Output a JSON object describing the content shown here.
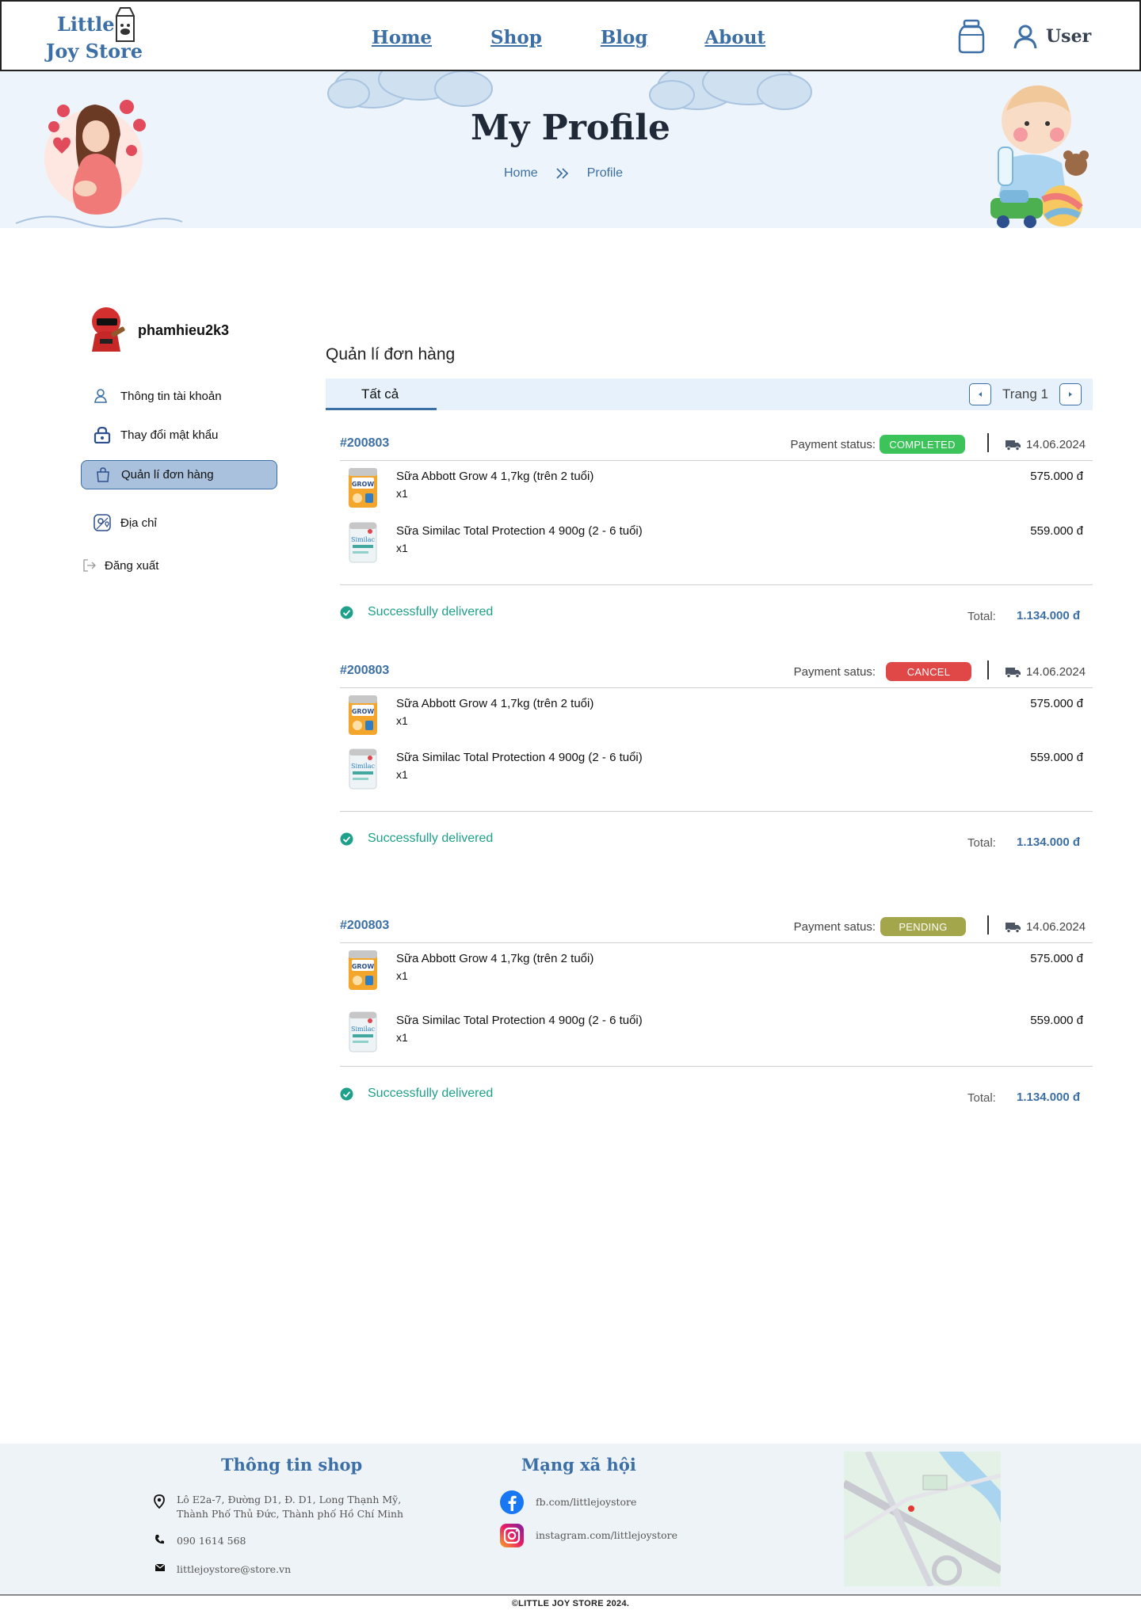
{
  "header": {
    "logo_line1": "Little",
    "logo_line2": "Joy Store",
    "nav": [
      "Home",
      "Shop",
      "Blog",
      "About"
    ],
    "user_label": "User"
  },
  "hero": {
    "title": "My Profile",
    "breadcrumb": [
      "Home",
      "Profile"
    ]
  },
  "sidebar": {
    "username": "phamhieu2k3",
    "menu": [
      {
        "label": "Thông tin tài khoản",
        "icon": "user-icon"
      },
      {
        "label": "Thay đổi mật khẩu",
        "icon": "lock-icon"
      },
      {
        "label": "Quản lí đơn hàng",
        "icon": "shopping-bag-icon",
        "active": true
      },
      {
        "label": "Địa chỉ",
        "icon": "map-pin-icon"
      },
      {
        "label": "Đăng xuất",
        "icon": "logout-icon"
      }
    ]
  },
  "orders_section": {
    "title": "Quản lí đơn hàng",
    "tab_all": "Tất cả",
    "page_label": "Trang 1"
  },
  "orders": [
    {
      "id": "#200803",
      "payment_label": "Payment status:",
      "status": "COMPLETED",
      "status_color": "#3cc45a",
      "date": "14.06.2024",
      "items": [
        {
          "name": "Sữa Abbott Grow 4 1,7kg (trên 2 tuổi)",
          "qty": "x1",
          "price": "575.000 đ"
        },
        {
          "name": "Sữa Similac Total Protection 4 900g (2 - 6 tuổi)",
          "qty": "x1",
          "price": "559.000 đ"
        }
      ],
      "delivery": "Successfully delivered",
      "total_label": "Total:",
      "total": "1.134.000 đ"
    },
    {
      "id": "#200803",
      "payment_label": "Payment satus:",
      "status": "CANCEL",
      "status_color": "#e04848",
      "date": "14.06.2024",
      "items": [
        {
          "name": "Sữa Abbott Grow 4 1,7kg (trên 2 tuổi)",
          "qty": "x1",
          "price": "575.000 đ"
        },
        {
          "name": "Sữa Similac Total Protection 4 900g (2 - 6 tuổi)",
          "qty": "x1",
          "price": "559.000 đ"
        }
      ],
      "delivery": "Successfully delivered",
      "total_label": "Total:",
      "total": "1.134.000 đ"
    },
    {
      "id": "#200803",
      "payment_label": "Payment satus:",
      "status": "PENDING",
      "status_color": "#a3a64a",
      "date": "14.06.2024",
      "items": [
        {
          "name": "Sữa Abbott Grow 4 1,7kg (trên 2 tuổi)",
          "qty": "x1",
          "price": "575.000 đ"
        },
        {
          "name": "Sữa Similac Total Protection 4 900g (2 - 6 tuổi)",
          "qty": "x1",
          "price": "559.000 đ"
        }
      ],
      "delivery": "Successfully delivered",
      "total_label": "Total:",
      "total": "1.134.000 đ"
    }
  ],
  "footer": {
    "shop_title": "Thông tin shop",
    "address_line1": "Lô E2a-7, Đường D1, Đ. D1, Long Thạnh Mỹ,",
    "address_line2": "Thành Phố Thủ Đức, Thành phố Hồ Chí Minh",
    "phone": "090 1614 568",
    "email": "littlejoystore@store.vn",
    "social_title": "Mạng xã hội",
    "facebook": "fb.com/littlejoystore",
    "instagram": "instagram.com/littlejoystore",
    "copyright": "©LITTLE JOY STORE 2024."
  },
  "colors": {
    "brand": "#3b6fa6",
    "success": "#1fa08a"
  }
}
